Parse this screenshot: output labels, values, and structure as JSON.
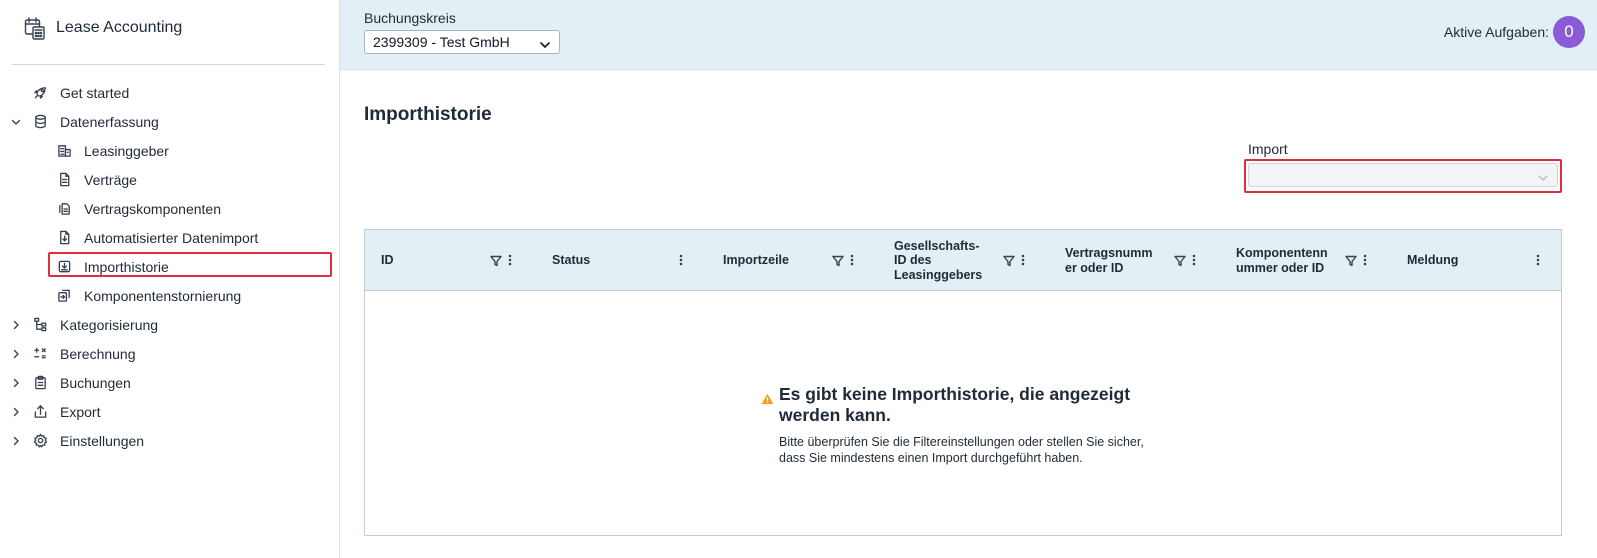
{
  "app": {
    "title": "Lease Accounting"
  },
  "sidebar": {
    "items": [
      {
        "label": "Get started",
        "icon": "rocket-icon"
      },
      {
        "label": "Datenerfassung",
        "icon": "database-icon",
        "expanded": true
      },
      {
        "label": "Leasinggeber",
        "icon": "building-icon"
      },
      {
        "label": "Verträge",
        "icon": "document-icon"
      },
      {
        "label": "Vertragskomponenten",
        "icon": "documents-icon"
      },
      {
        "label": "Automatisierter Datenimport",
        "icon": "file-import-icon"
      },
      {
        "label": "Importhistorie",
        "icon": "download-box-icon",
        "active": true
      },
      {
        "label": "Komponentenstornierung",
        "icon": "swap-icon"
      },
      {
        "label": "Kategorisierung",
        "icon": "hierarchy-icon"
      },
      {
        "label": "Berechnung",
        "icon": "calculator-icon"
      },
      {
        "label": "Buchungen",
        "icon": "clipboard-icon"
      },
      {
        "label": "Export",
        "icon": "upload-icon"
      },
      {
        "label": "Einstellungen",
        "icon": "gear-icon"
      }
    ]
  },
  "topbar": {
    "buchungskreis_label": "Buchungskreis",
    "buchungskreis_value": "2399309 - Test GmbH",
    "tasks_label": "Aktive Aufgaben:",
    "tasks_count": "0"
  },
  "main": {
    "page_title": "Importhistorie",
    "import_label": "Import",
    "import_value": ""
  },
  "table": {
    "columns": [
      {
        "label": "ID"
      },
      {
        "label": "Status"
      },
      {
        "label": "Importzeile"
      },
      {
        "label": "Gesellschafts-ID des Leasinggebers"
      },
      {
        "label": "Vertragsnummer oder ID"
      },
      {
        "label": "Komponentennummer oder ID"
      },
      {
        "label": "Meldung"
      }
    ],
    "empty_title": "Es gibt keine Importhistorie, die angezeigt werden kann.",
    "empty_text": "Bitte überprüfen Sie die Filtereinstellungen oder stellen Sie sicher, dass Sie mindestens einen Import durchgeführt haben."
  },
  "colors": {
    "accent_topbar": "#e2f0f5",
    "badge": "#8b5ad6",
    "highlight": "#e02e3c",
    "warning": "#f0a01e"
  }
}
